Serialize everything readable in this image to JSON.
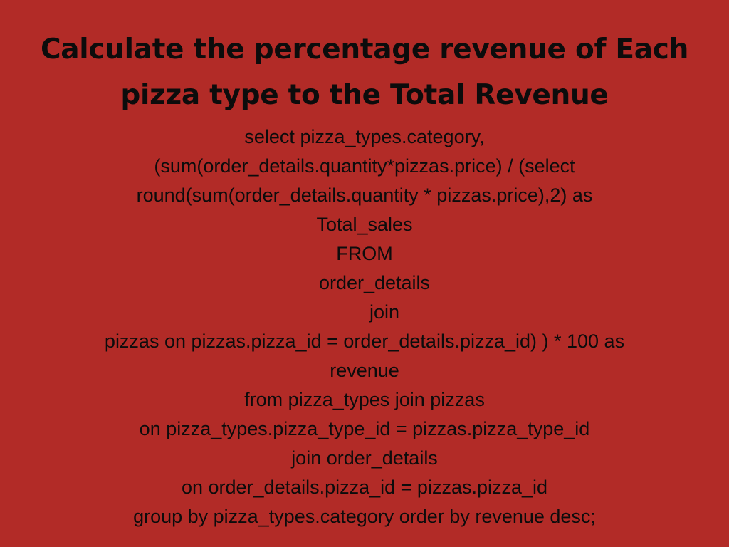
{
  "title": {
    "line1": "Calculate the percentage revenue of Each",
    "line2": "pizza type to the Total Revenue"
  },
  "query": {
    "lines": [
      "select pizza_types.category,",
      "(sum(order_details.quantity*pizzas.price) / (select",
      "round(sum(order_details.quantity * pizzas.price),2) as",
      "Total_sales",
      "FROM",
      "order_details",
      "join",
      "pizzas on pizzas.pizza_id = order_details.pizza_id) ) * 100 as",
      "revenue",
      "from pizza_types join pizzas",
      "on pizza_types.pizza_type_id = pizzas.pizza_type_id",
      "join order_details",
      "on order_details.pizza_id = pizzas.pizza_id",
      "group by pizza_types.category order by revenue desc;"
    ]
  },
  "colors": {
    "background": "#b22b27",
    "text": "#0c0c0c"
  }
}
